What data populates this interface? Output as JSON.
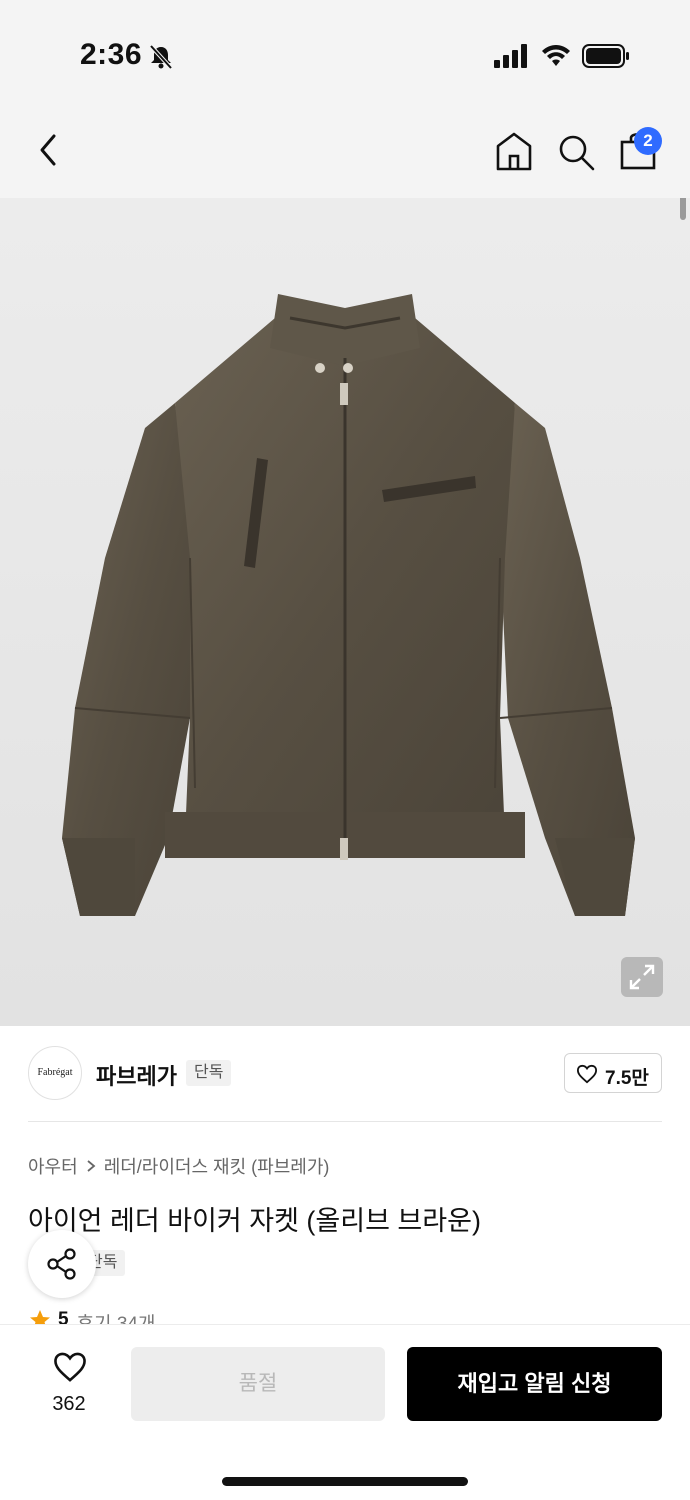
{
  "status_bar": {
    "time": "2:36",
    "icons": [
      "bell-slash-icon",
      "signal-icon",
      "wifi-icon",
      "battery-icon"
    ]
  },
  "nav": {
    "icons": [
      "back-icon",
      "home-icon",
      "search-icon",
      "cart-icon"
    ],
    "cart_badge": "2",
    "badge_color": "#2f6bff"
  },
  "product_image": {
    "subject": "olive brown leather biker jacket",
    "jacket_color": "#5c5446",
    "expand_icon": "expand-icon"
  },
  "brand": {
    "logo_text": "Fabrégat",
    "name": "파브레가",
    "tag": "단독",
    "like_count": "7.5만"
  },
  "product": {
    "breadcrumb": [
      "아우터",
      "레더/라이더스 재킷 (파브레가)"
    ],
    "title": "아이언 레더 바이커 자켓 (올리브 브라운)",
    "tag": "단독",
    "rating": "5",
    "reviews": "후기 34개",
    "star_color": "#f59e0b"
  },
  "bottom_bar": {
    "wish_count": "362",
    "soldout_label": "품절",
    "restock_label": "재입고 알림 신청"
  }
}
